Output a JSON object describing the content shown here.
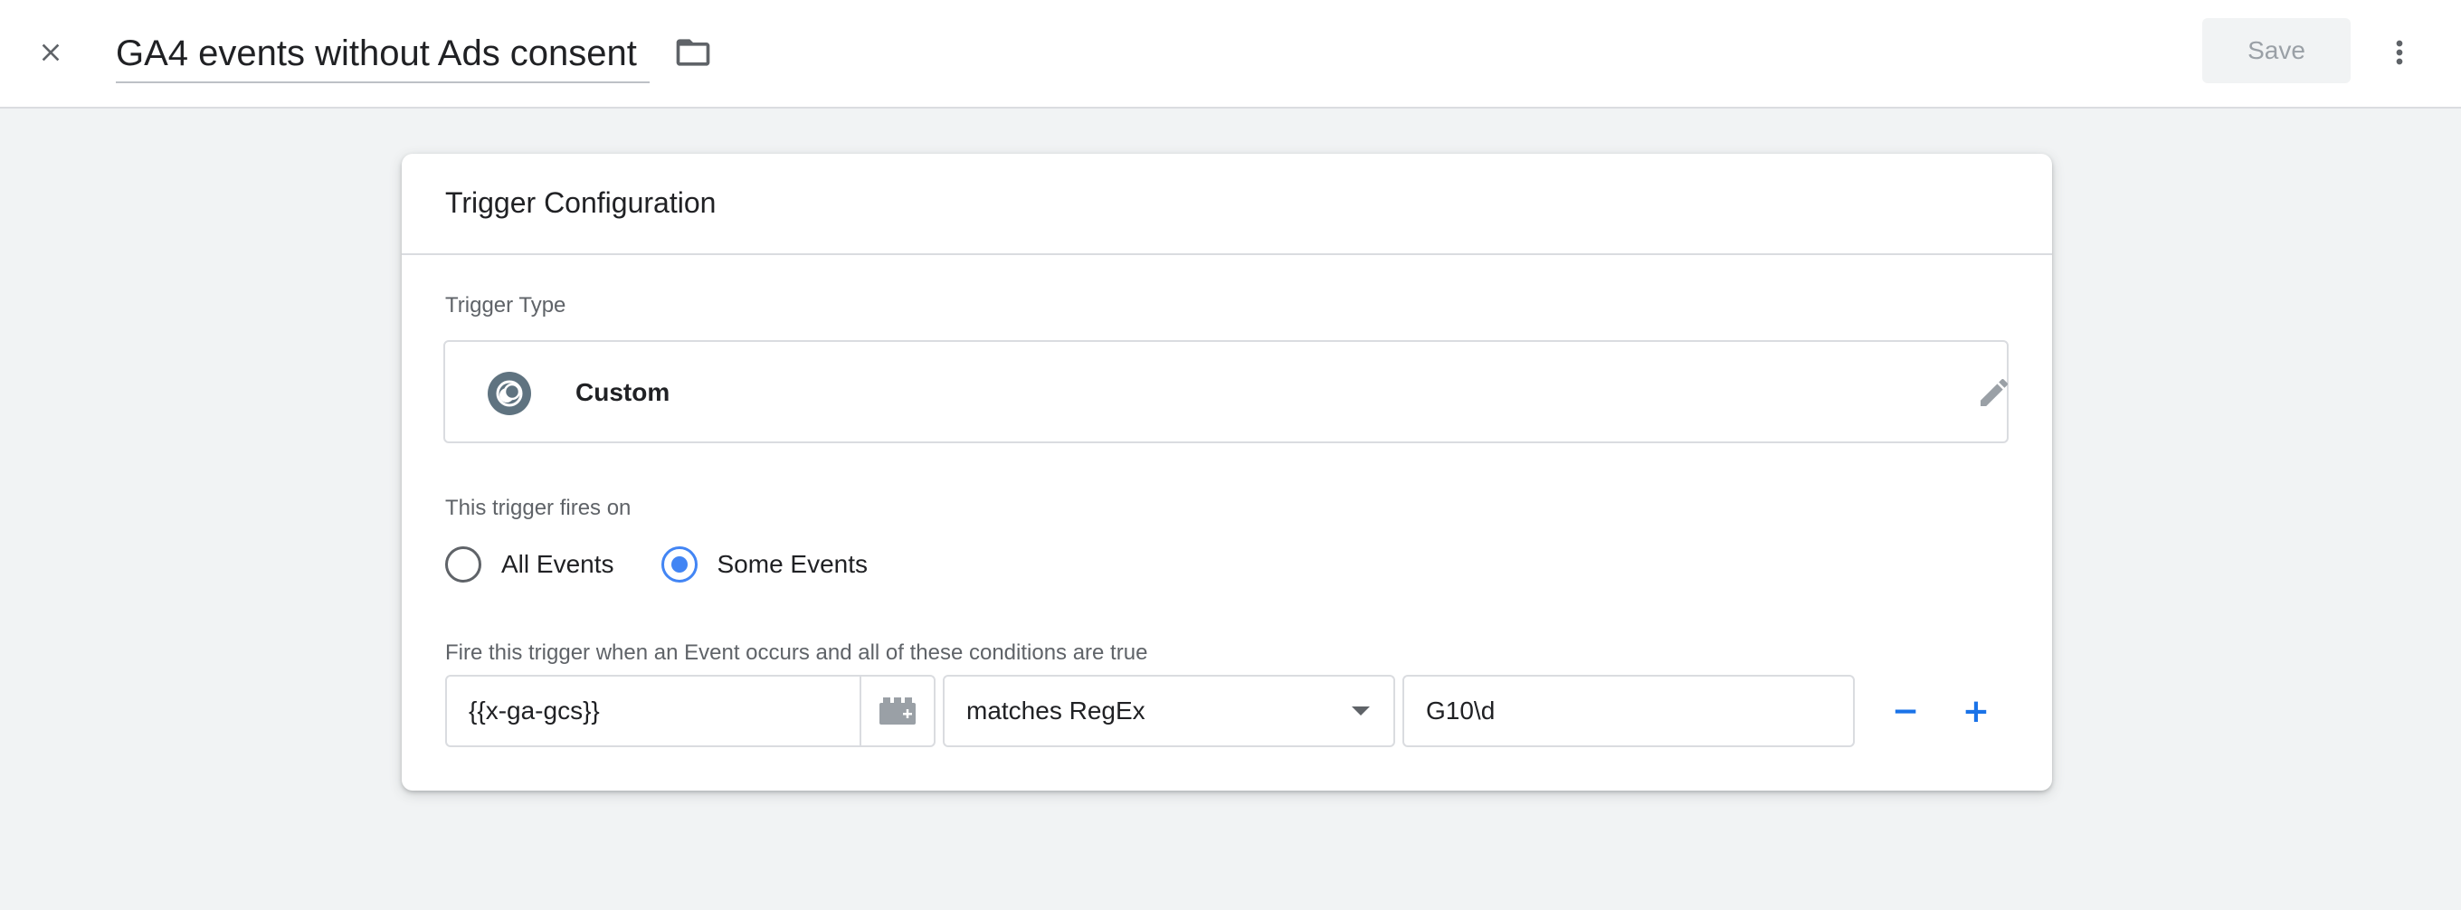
{
  "header": {
    "title": "GA4 events without Ads consent",
    "save_label": "Save"
  },
  "card": {
    "title": "Trigger Configuration",
    "trigger_type_label": "Trigger Type",
    "trigger_type_name": "Custom",
    "fires_on_label": "This trigger fires on",
    "fires_on_options": [
      {
        "label": "All Events",
        "checked": false
      },
      {
        "label": "Some Events",
        "checked": true
      }
    ],
    "conditions_label": "Fire this trigger when an Event occurs and all of these conditions are true",
    "condition": {
      "variable": "{{x-ga-gcs}}",
      "operator": "matches RegEx",
      "value": "G10\\d",
      "remove_label": "−",
      "add_label": "+"
    }
  },
  "colors": {
    "accent": "#1a73e8",
    "radio_checked": "#4285f4",
    "background": "#f1f3f4"
  },
  "icons": {
    "close": "close-icon",
    "folder": "folder-icon",
    "more": "more-vert-icon",
    "trigger_type": "custom-event-icon",
    "edit": "pencil-icon",
    "variable_picker": "add-variable-icon",
    "caret": "chevron-down-icon"
  }
}
